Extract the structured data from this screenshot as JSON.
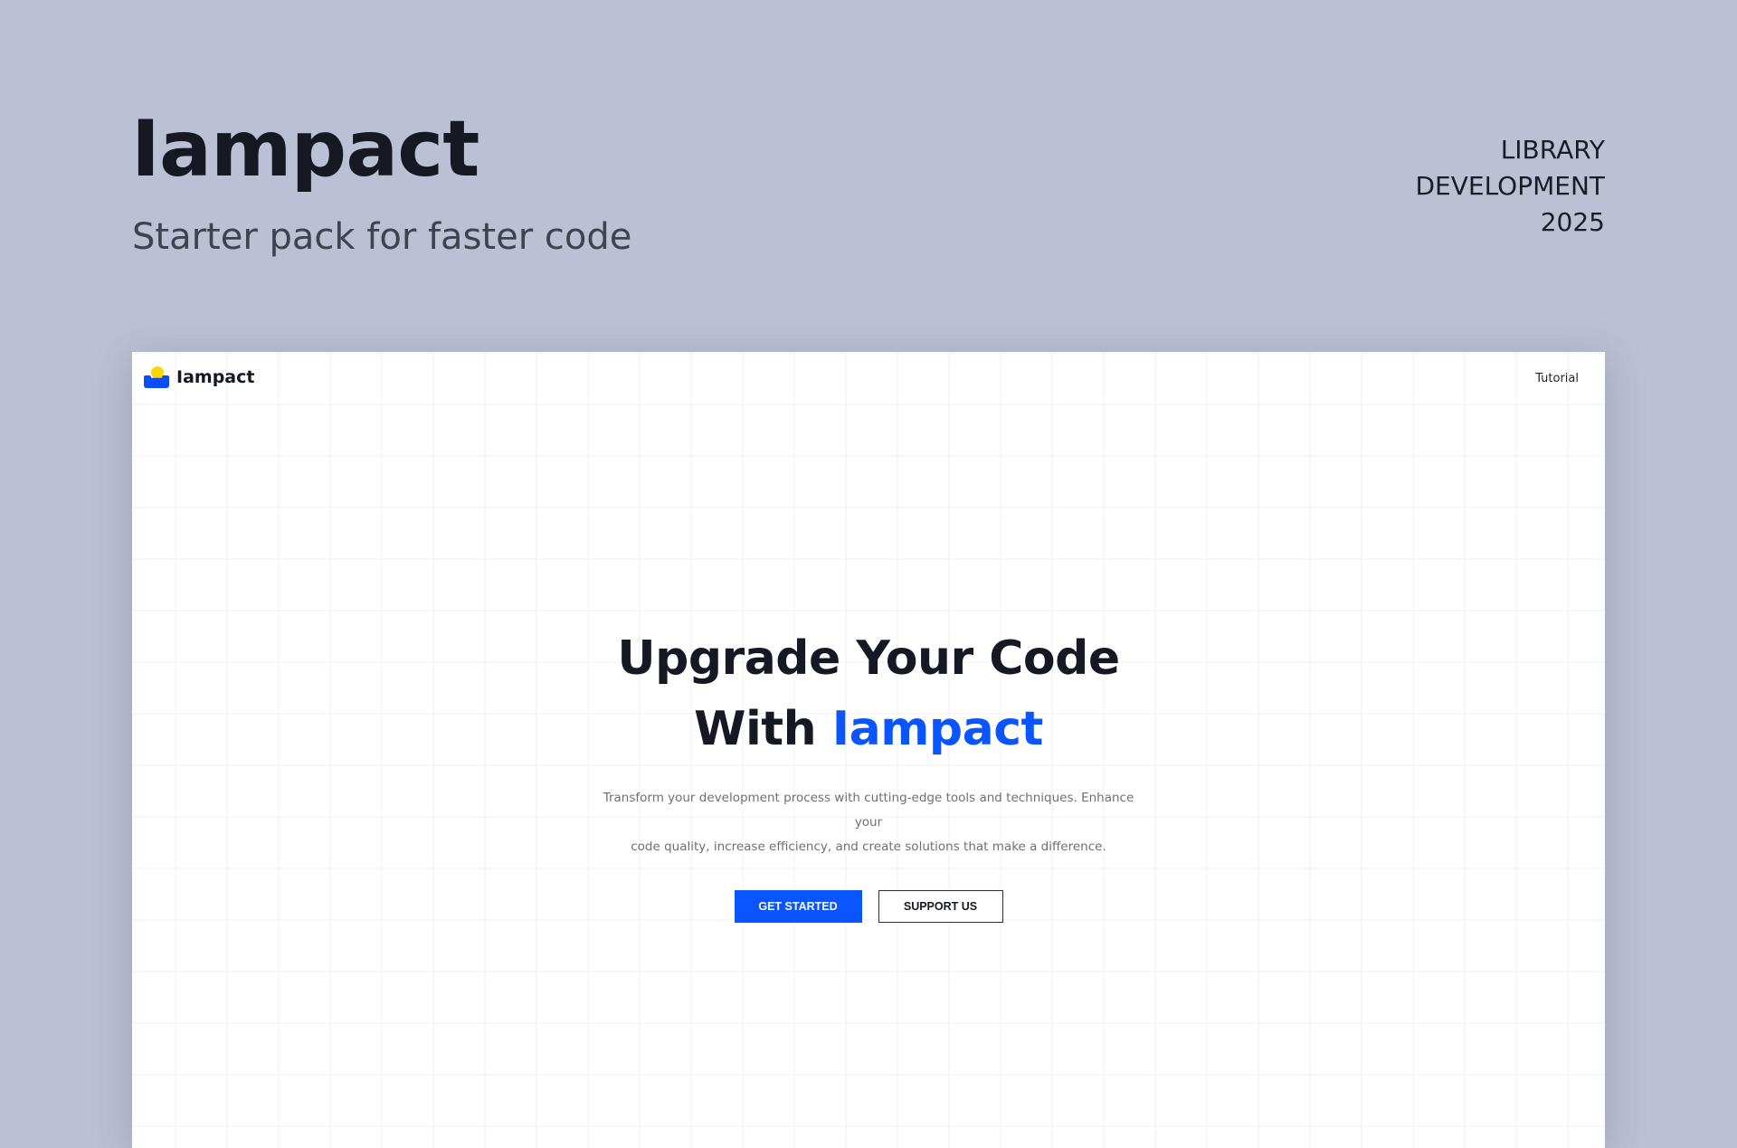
{
  "header": {
    "title": "Iampact",
    "subtitle": "Starter pack for faster code",
    "meta_lines": [
      "LIBRARY",
      "DEVELOPMENT",
      "2025"
    ]
  },
  "preview": {
    "nav": {
      "logo_text": "Iampact",
      "logo_icon": "sun-over-house-logo-icon",
      "link": "Tutorial"
    },
    "hero": {
      "heading_line1": "Upgrade Your Code",
      "heading_line2_prefix": "With",
      "heading_line2_accent": "Iampact",
      "description_line1": "Transform your development process with cutting-edge tools and techniques. Enhance your",
      "description_line2": "code quality, increase efficiency, and create solutions that make a difference.",
      "primary_button": "GET STARTED",
      "secondary_button": "SUPPORT US"
    }
  },
  "colors": {
    "background": "#bcc0d4",
    "accent": "#0a55ff",
    "logo_sun": "#ffd600",
    "text_dark": "#161924"
  }
}
